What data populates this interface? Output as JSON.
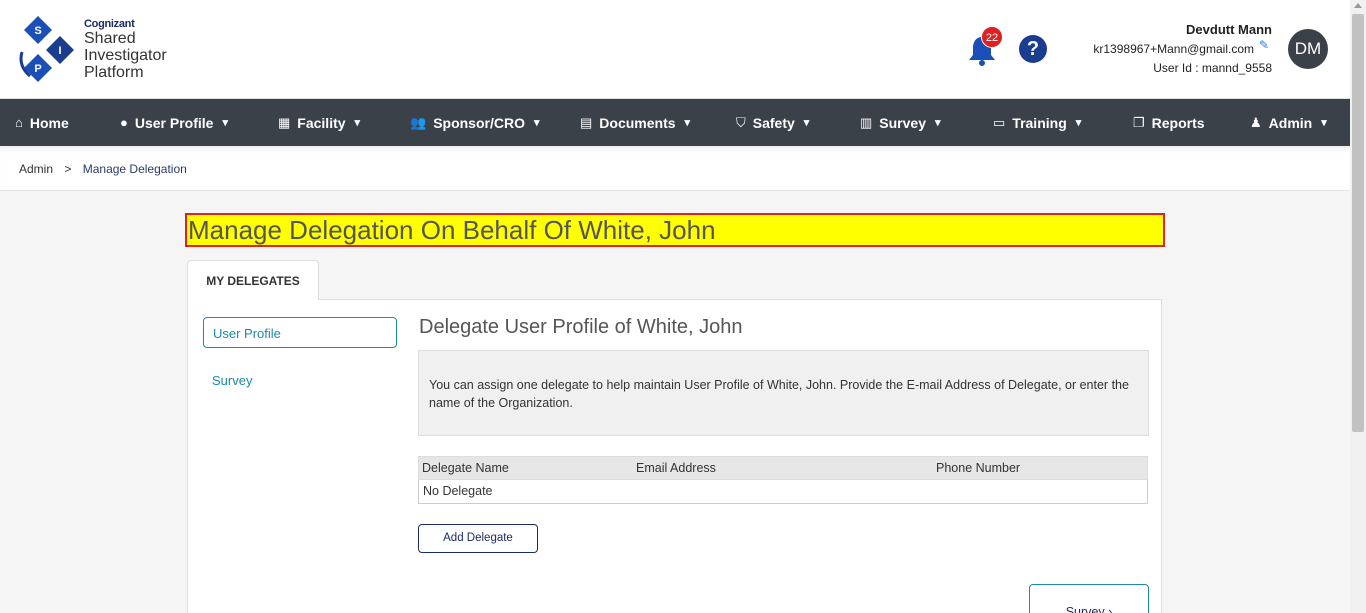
{
  "header": {
    "logo": {
      "brand": "Cognizant",
      "line1": "Shared",
      "line2": "Investigator",
      "line3": "Platform",
      "letters": [
        "S",
        "I",
        "P"
      ]
    },
    "notifications_count": "22",
    "help_symbol": "?",
    "user": {
      "name": "Devdutt Mann",
      "email": "kr1398967+Mann@gmail.com",
      "user_id": "User Id : mannd_9558",
      "initials": "DM"
    }
  },
  "nav": {
    "items": [
      {
        "label": "Home",
        "icon": "home-icon"
      },
      {
        "label": "User Profile",
        "icon": "user-circle-icon"
      },
      {
        "label": "Facility",
        "icon": "building-icon"
      },
      {
        "label": "Sponsor/CRO",
        "icon": "users-icon"
      },
      {
        "label": "Documents",
        "icon": "document-icon"
      },
      {
        "label": "Safety",
        "icon": "shield-icon"
      },
      {
        "label": "Survey",
        "icon": "chart-icon"
      },
      {
        "label": "Training",
        "icon": "laptop-icon"
      },
      {
        "label": "Reports",
        "icon": "reports-icon"
      },
      {
        "label": "Admin",
        "icon": "user-icon"
      }
    ]
  },
  "breadcrumb": {
    "root": "Admin",
    "separator": ">",
    "current": "Manage Delegation"
  },
  "main": {
    "title": "Manage Delegation On Behalf Of White, John",
    "tab": "MY DELEGATES",
    "side_items": [
      "User Profile",
      "Survey"
    ],
    "sub_title": "Delegate User Profile of White, John",
    "info": "You can assign one delegate to help maintain User Profile of White, John. Provide the E-mail Address of Delegate, or enter the name of the Organization.",
    "table": {
      "headers": [
        "Delegate Name",
        "Email Address",
        "Phone Number"
      ],
      "empty": "No Delegate"
    },
    "add_button": "Add Delegate",
    "survey_button": "Survey"
  },
  "colors": {
    "nav_bg": "#3a4149",
    "highlight": "#ffff00",
    "accent": "#1b8aa8",
    "brand_blue": "#1a3d8f"
  }
}
